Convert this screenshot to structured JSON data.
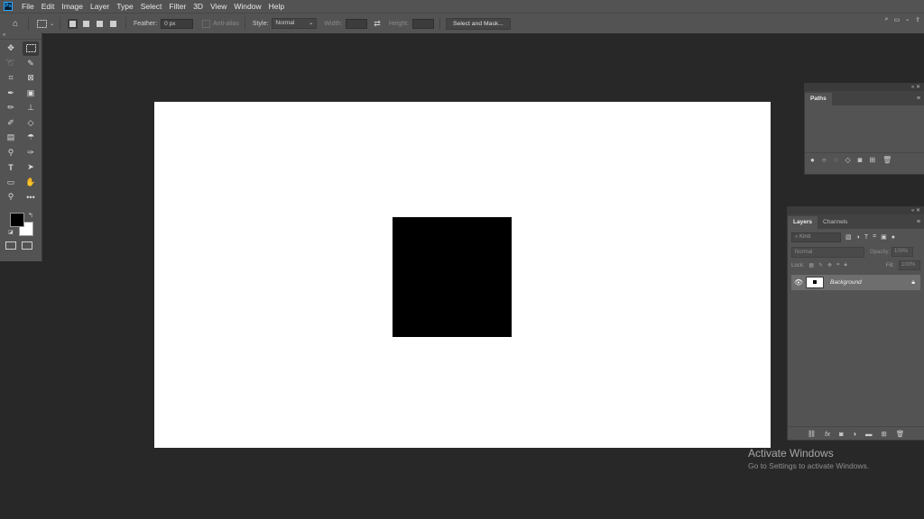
{
  "menubar": {
    "logo": "Ps",
    "items": [
      "File",
      "Edit",
      "Image",
      "Layer",
      "Type",
      "Select",
      "Filter",
      "3D",
      "View",
      "Window",
      "Help"
    ]
  },
  "options": {
    "feather_label": "Feather:",
    "feather_value": "0 px",
    "antialias_label": "Anti-alias",
    "style_label": "Style:",
    "style_value": "Normal",
    "width_label": "Width:",
    "height_label": "Height:",
    "select_mask_label": "Select and Mask..."
  },
  "panels": {
    "paths": {
      "tab": "Paths"
    },
    "layers": {
      "tabs": [
        "Layers",
        "Channels"
      ],
      "kind_placeholder": "Kind",
      "blend_mode": "Normal",
      "opacity_label": "Opacity:",
      "opacity_value": "100%",
      "lock_label": "Lock:",
      "fill_label": "Fill:",
      "fill_value": "100%",
      "layer_name": "Background"
    }
  },
  "watermark": {
    "title": "Activate Windows",
    "subtitle": "Go to Settings to activate Windows."
  },
  "colors": {
    "foreground": "#000000",
    "background": "#ffffff"
  }
}
